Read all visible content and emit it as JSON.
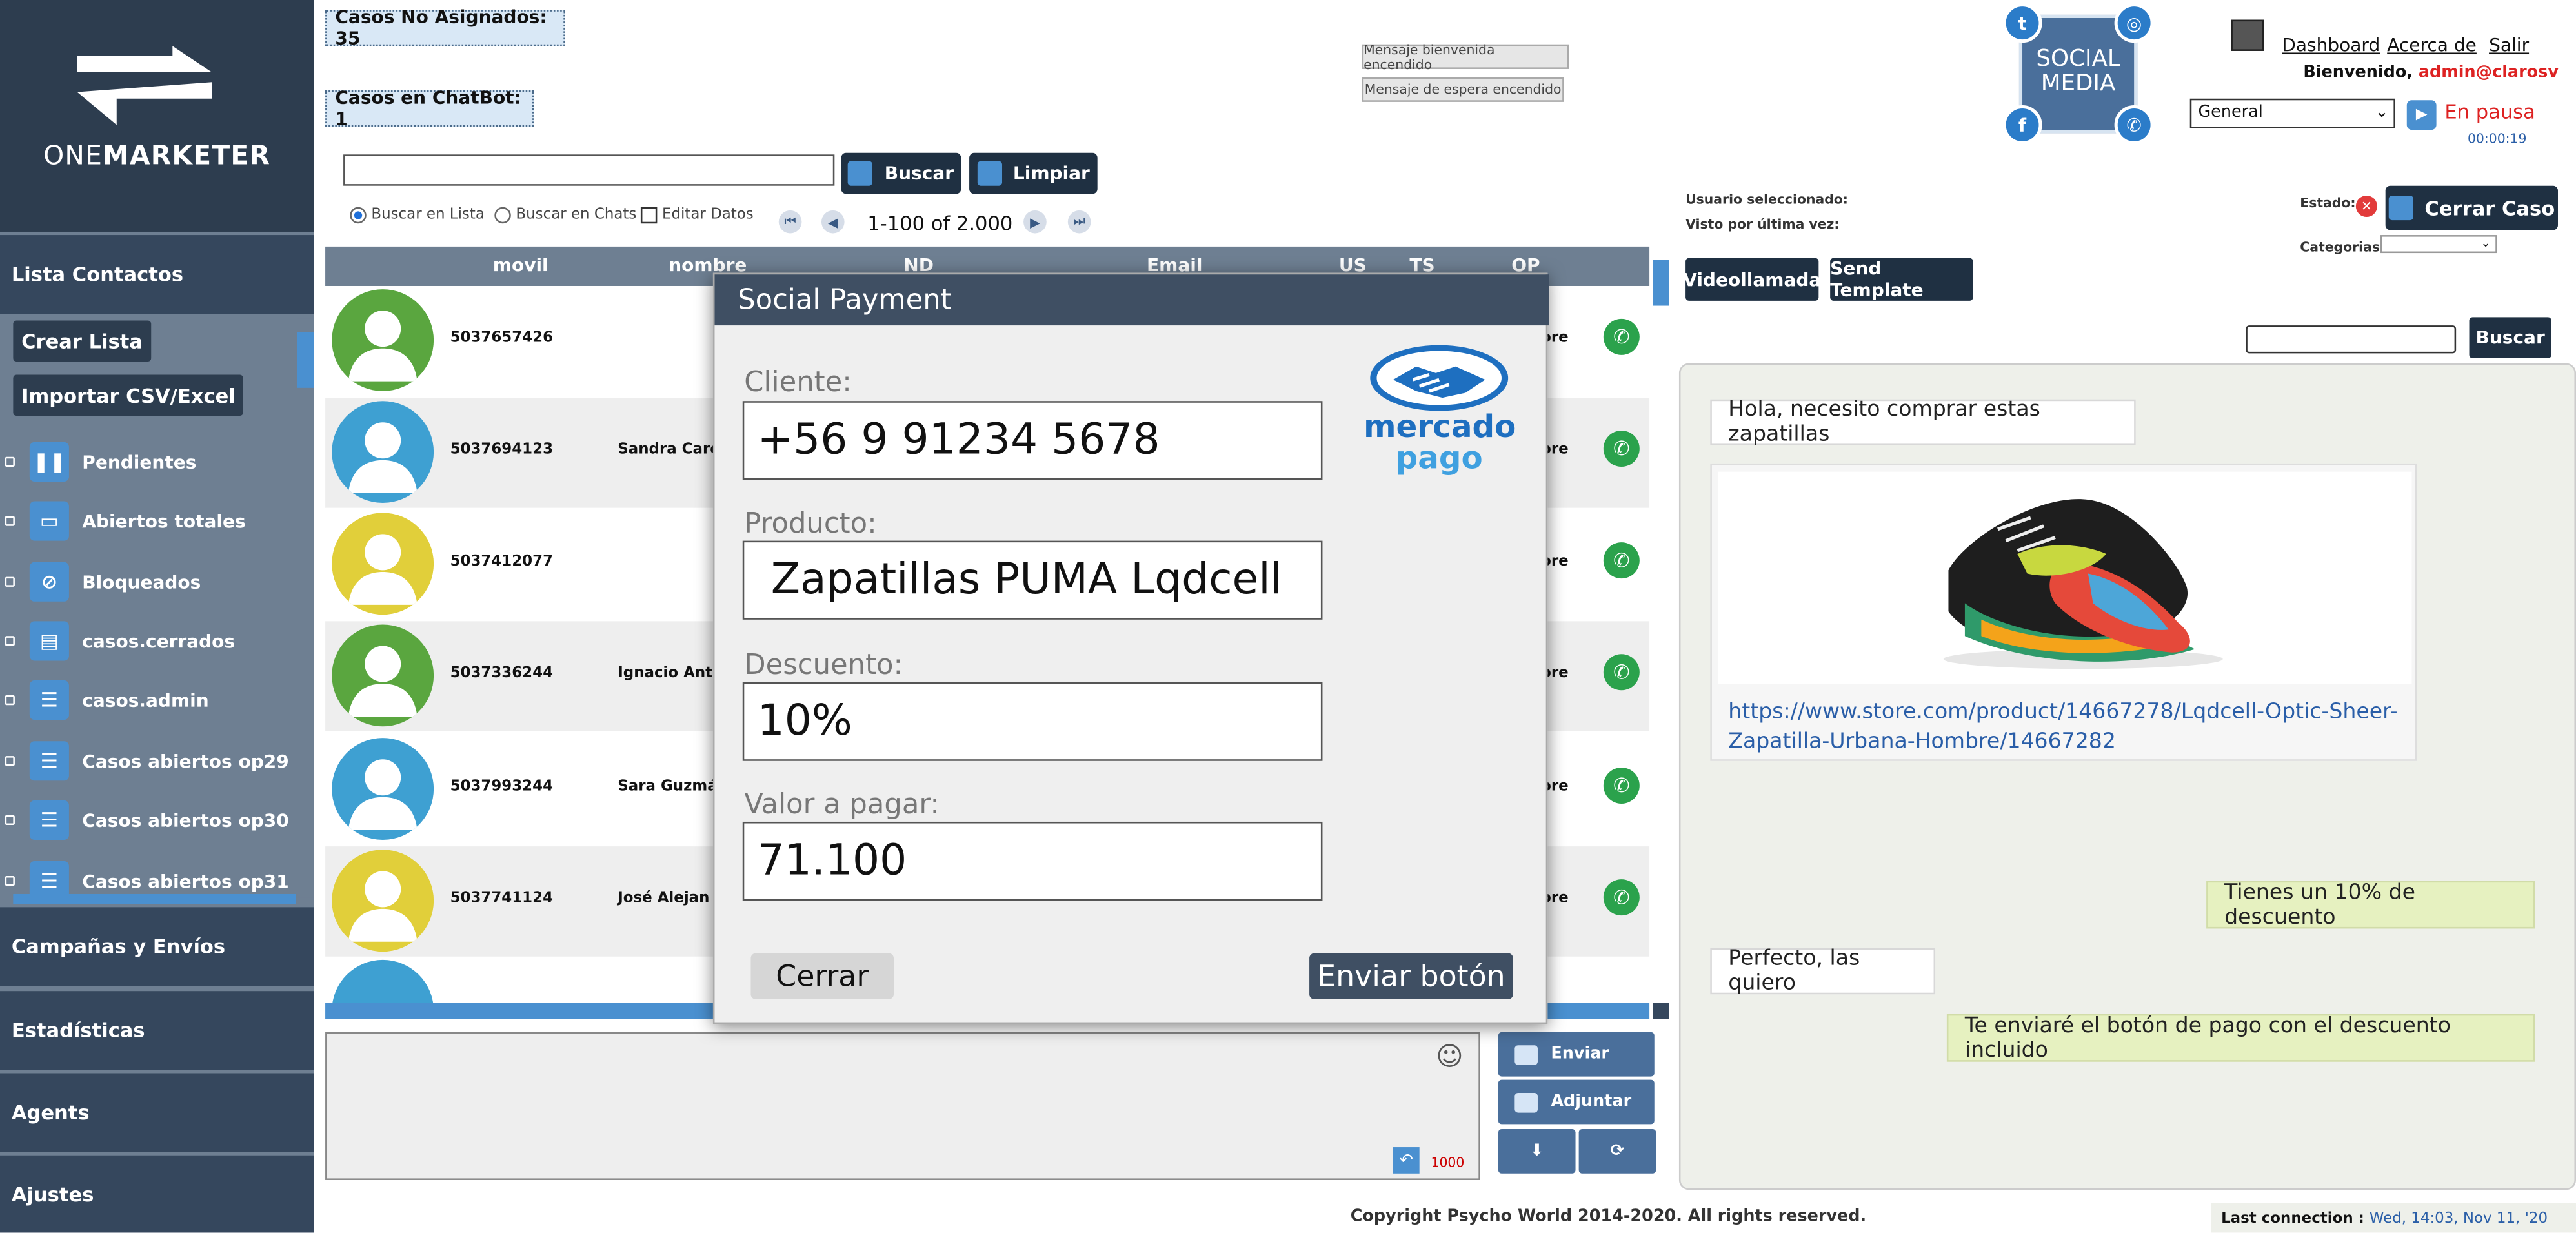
{
  "sidebar": {
    "logo": "ONEMARKETER",
    "logo_light": "ONE",
    "logo_bold": "MARKETER",
    "lista_contactos": "Lista Contactos",
    "crear_lista": "Crear Lista",
    "importar": "Importar CSV/Excel",
    "items": [
      {
        "label": "Pendientes",
        "icon": "pause-icon"
      },
      {
        "label": "Abiertos totales",
        "icon": "monitor-icon"
      },
      {
        "label": "Bloqueados",
        "icon": "block-icon"
      },
      {
        "label": "casos.cerrados",
        "icon": "clipboard-icon"
      },
      {
        "label": "casos.admin",
        "icon": "list-icon"
      },
      {
        "label": "Casos abiertos op29",
        "icon": "list-icon"
      },
      {
        "label": "Casos abiertos op30",
        "icon": "list-icon"
      },
      {
        "label": "Casos abiertos op31",
        "icon": "list-icon"
      }
    ],
    "campanas": "Campañas y Envíos",
    "estadisticas": "Estadísticas",
    "agents": "Agents",
    "ajustes": "Ajustes"
  },
  "top": {
    "casos_no_asignados": "Casos No Asignados: 35",
    "casos_chatbot": "Casos en ChatBot: 1",
    "msg_bienvenida": "Mensaje bienvenida encendido",
    "msg_espera": "Mensaje de espera encendido",
    "buscar": "Buscar",
    "limpiar": "Limpiar",
    "buscar_lista": "Buscar en Lista",
    "buscar_chats": "Buscar en Chats",
    "editar_datos": "Editar Datos",
    "pagination": "1-100 of 2.000"
  },
  "table": {
    "headers": [
      "movil",
      "nombre",
      "ND",
      "Email",
      "US",
      "TS",
      "OP"
    ],
    "rows": [
      {
        "movil": "5037657426",
        "nombre": "",
        "avatar_color": "#5aa63f",
        "op": "ore"
      },
      {
        "movil": "5037694123",
        "nombre": "Sandra Caro",
        "avatar_color": "#3ea0d2",
        "op": "ore"
      },
      {
        "movil": "5037412077",
        "nombre": "",
        "avatar_color": "#e1cf3a",
        "op": "ore"
      },
      {
        "movil": "5037336244",
        "nombre": "Ignacio Ant",
        "avatar_color": "#5aa63f",
        "op": "ore"
      },
      {
        "movil": "5037993244",
        "nombre": "Sara Guzmá",
        "avatar_color": "#3ea0d2",
        "op": "ore"
      },
      {
        "movil": "5037741124",
        "nombre": "José Alejan",
        "avatar_color": "#e1cf3a",
        "op": "ore"
      }
    ]
  },
  "compose": {
    "enviar": "Enviar",
    "adjuntar": "Adjuntar",
    "counter": "1000"
  },
  "modal": {
    "title": "Social Payment",
    "cliente_label": "Cliente:",
    "cliente_value": "+56 9 91234 5678",
    "producto_label": "Producto:",
    "producto_value": " Zapatillas PUMA Lqdcell",
    "descuento_label": "Descuento:",
    "descuento_value": "10%",
    "valor_label": "Valor a pagar:",
    "valor_value": "71.100",
    "cerrar": "Cerrar",
    "enviar_boton": "Enviar botón",
    "brand_top": "mercado",
    "brand_bottom": "pago"
  },
  "right": {
    "social_top": "SOCIAL",
    "social_bottom": "MEDIA",
    "dashboard": "Dashboard",
    "acerca": "Acerca de",
    "salir": "Salir",
    "bienvenido": "Bienvenido, ",
    "user": "admin@clarosv",
    "select_value": "General",
    "en_pausa": "En pausa",
    "timer": "00:00:19",
    "usuario_sel": "Usuario seleccionado:",
    "visto": "Visto por última vez:",
    "estado": "Estado:",
    "cerrar_caso": "Cerrar Caso",
    "categorias": "Categorias:",
    "videollamada": "Videollamada",
    "send_template": "Send Template",
    "buscar": "Buscar"
  },
  "chat": {
    "m1": "Hola, necesito comprar estas zapatillas",
    "link": "https://www.store.com/product/14667278/Lqdcell-Optic-Sheer-Zapatilla-Urbana-Hombre/14667282",
    "m2": "Tienes un 10% de descuento",
    "m3": "Perfecto, las quiero",
    "m4": "Te enviaré el botón de pago con el descuento incluido"
  },
  "footer": {
    "copyright": "Copyright Psycho World 2014-2020. All rights reserved.",
    "last_label": "Last connection : ",
    "last_value": "Wed, 14:03, Nov 11, '20"
  },
  "colors": {
    "sidebar": "#6e7f92",
    "sidebar_dark": "#2d3d4f",
    "accent": "#4a90d0",
    "modal_header": "#3f4f63",
    "out_bubble": "#e6f1c0"
  }
}
